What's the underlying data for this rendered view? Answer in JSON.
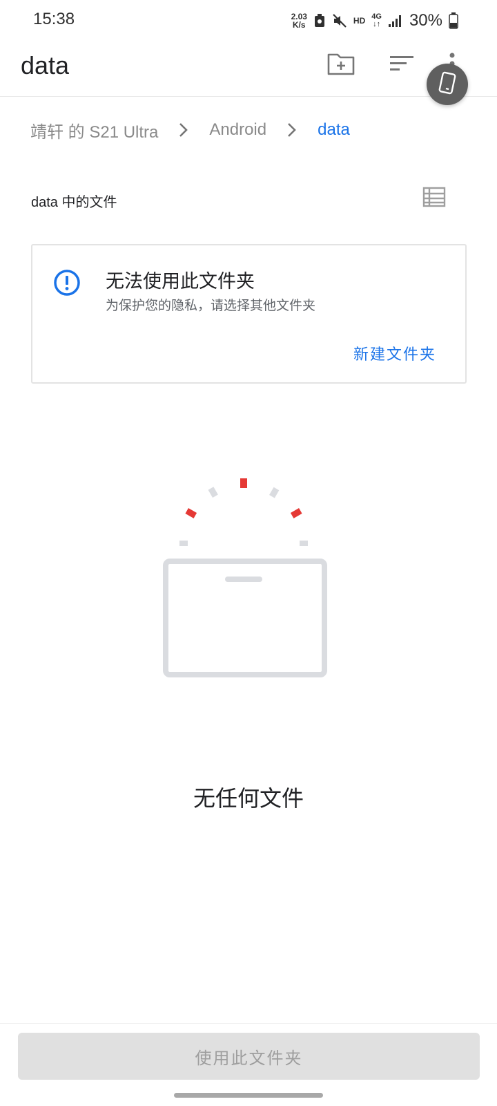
{
  "status_bar": {
    "time": "15:38",
    "net_speed_value": "2.03",
    "net_speed_unit": "K/s",
    "hd": "HD",
    "network": "4G",
    "battery_percent": "30%"
  },
  "app_bar": {
    "title": "data",
    "actions": [
      "new-folder-icon",
      "sort-icon",
      "more-vert-icon"
    ],
    "floating_button_icon": "phone-icon"
  },
  "breadcrumb": {
    "items": [
      "靖轩 的 S21 Ultra",
      "Android",
      "data"
    ],
    "active_index": 2
  },
  "section": {
    "title": "data 中的文件",
    "view_toggle_icon": "list-view-icon"
  },
  "warning_card": {
    "icon": "info-icon",
    "title": "无法使用此文件夹",
    "subtitle": "为保护您的隐私，请选择其他文件夹",
    "action_label": "新建文件夹"
  },
  "empty_state": {
    "illustration": "empty-box-illustration",
    "text": "无任何文件"
  },
  "bottom": {
    "use_folder_label": "使用此文件夹"
  },
  "colors": {
    "accent": "#1a73e8",
    "illustration_red": "#e53935",
    "illustration_gray": "#dadce0",
    "button_disabled_bg": "#e0e0e0",
    "button_disabled_text": "#9e9e9e"
  }
}
